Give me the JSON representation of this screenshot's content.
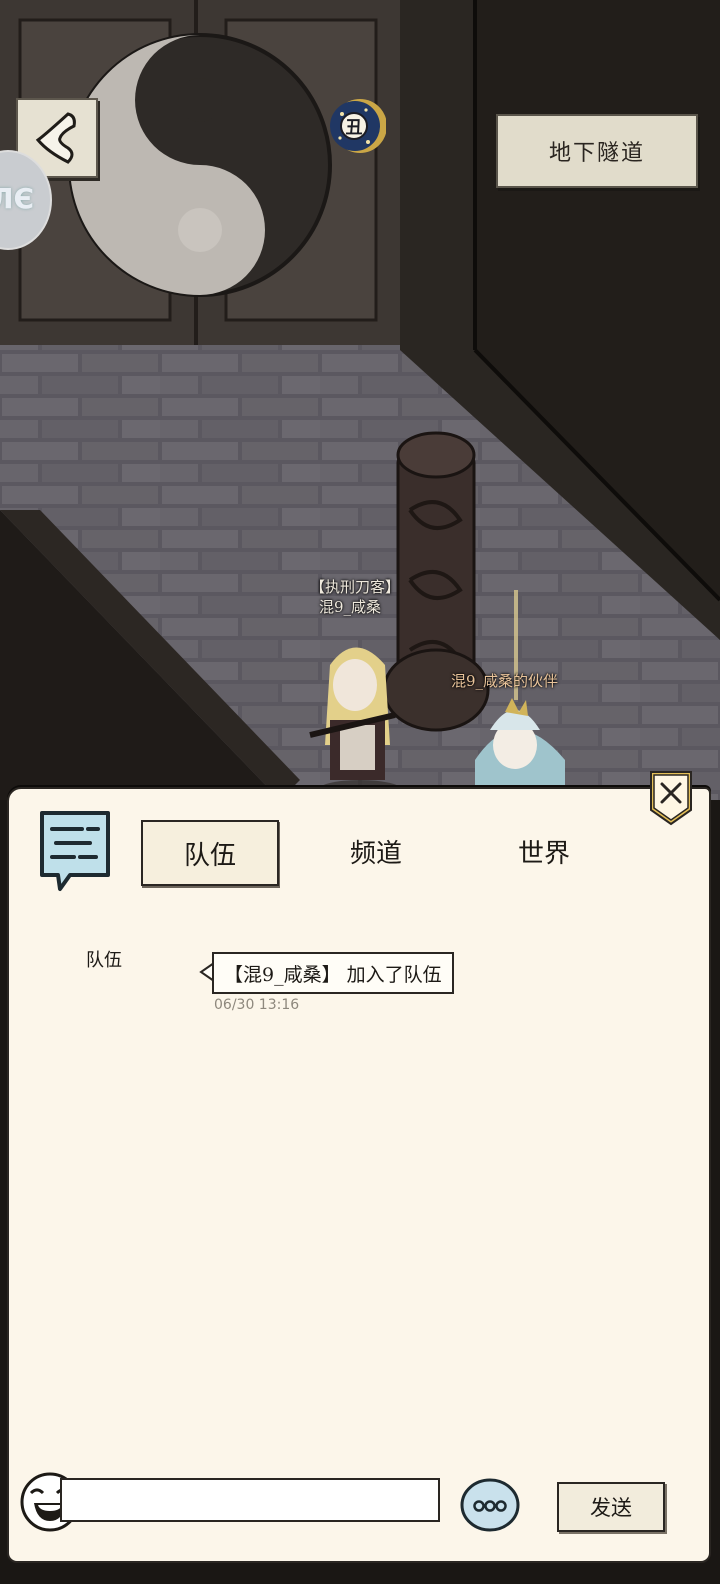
{
  "location": {
    "name": "地下隧道"
  },
  "time_badge": {
    "glyph": "丑"
  },
  "side_badge": {
    "text": "ЛЄ"
  },
  "characters": {
    "player_title": "【执刑刀客】",
    "player_name": "混9_咸桑",
    "partner_name": "混9_咸桑的伙伴"
  },
  "chat": {
    "tabs": [
      {
        "label": "队伍",
        "active": true
      },
      {
        "label": "频道",
        "active": false
      },
      {
        "label": "世界",
        "active": false
      }
    ],
    "messages": [
      {
        "channel": "队伍",
        "text": "【混9_咸桑】 加入了队伍",
        "time": "06/30 13:16"
      }
    ],
    "input": {
      "value": "",
      "placeholder": ""
    },
    "send_label": "发送"
  },
  "icons": {
    "back": "back-chevron-icon",
    "close": "close-icon",
    "chat": "chat-bubble-icon",
    "emoji": "laughing-face-icon",
    "more": "more-dots-icon"
  }
}
